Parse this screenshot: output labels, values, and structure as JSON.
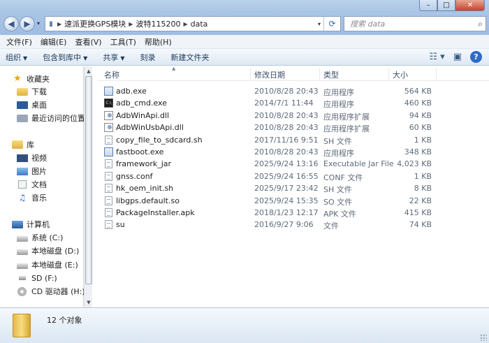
{
  "window": {
    "controls": {
      "minimize": "–",
      "maximize": "□",
      "close": "✕"
    }
  },
  "navigation": {
    "back": "◀",
    "forward": "▶",
    "address_crumbs": [
      "速派更换GPS模块",
      "波特115200",
      "data"
    ],
    "search_placeholder": "搜索 data"
  },
  "menu": [
    "文件(F)",
    "编辑(E)",
    "查看(V)",
    "工具(T)",
    "帮助(H)"
  ],
  "commands": {
    "organize": "组织",
    "include_in_library": "包含到库中",
    "share": "共享",
    "burn": "刻录",
    "new_folder": "新建文件夹",
    "help": "?"
  },
  "sidebar": {
    "favorites": {
      "label": "收藏夹",
      "items": [
        "下载",
        "桌面",
        "最近访问的位置"
      ]
    },
    "libraries": {
      "label": "库",
      "items": [
        "视频",
        "图片",
        "文档",
        "音乐"
      ]
    },
    "computer": {
      "label": "计算机",
      "items": [
        "系统 (C:)",
        "本地磁盘 (D:)",
        "本地磁盘 (E:)",
        "SD (F:)",
        "CD 驱动器 (H:)"
      ]
    }
  },
  "columns": {
    "name": "名称",
    "date": "修改日期",
    "type": "类型",
    "size": "大小"
  },
  "files": [
    {
      "name": "adb.exe",
      "date": "2010/8/28 20:43",
      "type": "应用程序",
      "size": "564 KB",
      "icon": "exe-icon"
    },
    {
      "name": "adb_cmd.exe",
      "date": "2014/7/1 11:44",
      "type": "应用程序",
      "size": "460 KB",
      "icon": "cmd-icon"
    },
    {
      "name": "AdbWinApi.dll",
      "date": "2010/8/28 20:43",
      "type": "应用程序扩展",
      "size": "94 KB",
      "icon": "dll-icon"
    },
    {
      "name": "AdbWinUsbApi.dll",
      "date": "2010/8/28 20:43",
      "type": "应用程序扩展",
      "size": "60 KB",
      "icon": "dll-icon"
    },
    {
      "name": "copy_file_to_sdcard.sh",
      "date": "2017/11/16 9:51",
      "type": "SH 文件",
      "size": "1 KB",
      "icon": "file-icon"
    },
    {
      "name": "fastboot.exe",
      "date": "2010/8/28 20:43",
      "type": "应用程序",
      "size": "348 KB",
      "icon": "exe-icon"
    },
    {
      "name": "framework_jar",
      "date": "2025/9/24 13:16",
      "type": "Executable Jar File",
      "size": "4,023 KB",
      "icon": "file-icon"
    },
    {
      "name": "gnss.conf",
      "date": "2025/9/24 16:55",
      "type": "CONF 文件",
      "size": "1 KB",
      "icon": "file-icon"
    },
    {
      "name": "hk_oem_init.sh",
      "date": "2025/9/17 23:42",
      "type": "SH 文件",
      "size": "8 KB",
      "icon": "file-icon"
    },
    {
      "name": "libgps.default.so",
      "date": "2025/9/24 15:35",
      "type": "SO 文件",
      "size": "22 KB",
      "icon": "file-icon"
    },
    {
      "name": "PackageInstaller.apk",
      "date": "2018/1/23 12:17",
      "type": "APK 文件",
      "size": "415 KB",
      "icon": "file-icon"
    },
    {
      "name": "su",
      "date": "2016/9/27 9:06",
      "type": "文件",
      "size": "74 KB",
      "icon": "file-icon"
    }
  ],
  "status": {
    "count": "12 个对象"
  }
}
